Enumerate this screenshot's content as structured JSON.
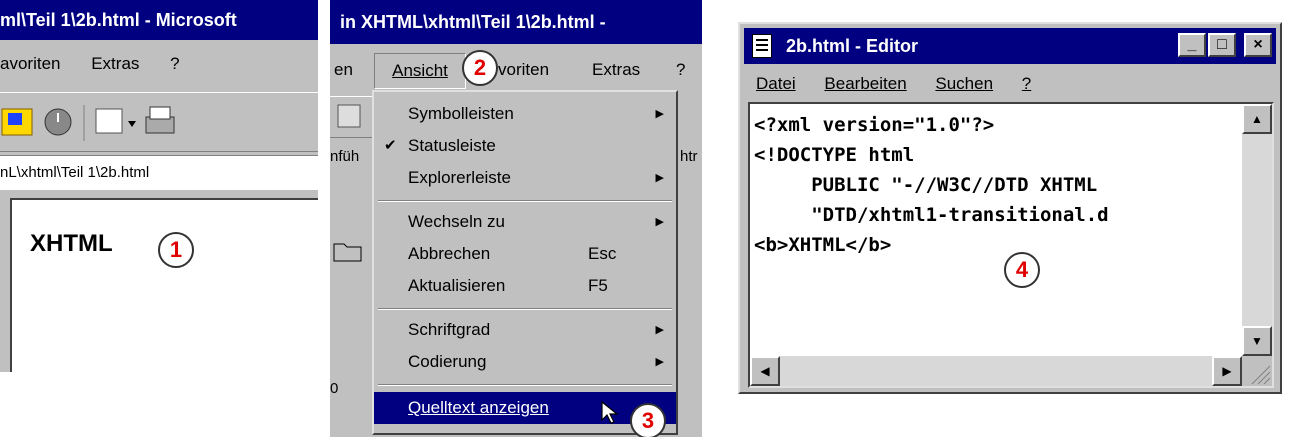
{
  "panel1": {
    "title": "ml\\Teil 1\\2b.html - Microsoft",
    "menu": [
      "avoriten",
      "Extras",
      "?"
    ],
    "address": "nL\\xhtml\\Teil 1\\2b.html",
    "content_text": "XHTML",
    "callout": "1"
  },
  "panel2": {
    "title": "in XHTML\\xhtml\\Teil 1\\2b.html -",
    "menu": {
      "partial": "en",
      "ansicht": "Ansicht",
      "favoriten": "voriten",
      "extras": "Extras",
      "help": "?"
    },
    "callout_menu": "2",
    "callout_source": "3",
    "bg_fragments": [
      "nfüh",
      "htr",
      "0"
    ],
    "dropdown": [
      {
        "label": "Symbolleisten",
        "shortcut": "",
        "submenu": true,
        "checked": false
      },
      {
        "label": "Statusleiste",
        "shortcut": "",
        "submenu": false,
        "checked": true
      },
      {
        "label": "Explorerleiste",
        "shortcut": "",
        "submenu": true,
        "checked": false
      },
      {
        "label": "Wechseln zu",
        "shortcut": "",
        "submenu": true,
        "checked": false
      },
      {
        "label": "Abbrechen",
        "shortcut": "Esc",
        "submenu": false,
        "checked": false
      },
      {
        "label": "Aktualisieren",
        "shortcut": "F5",
        "submenu": false,
        "checked": false
      },
      {
        "label": "Schriftgrad",
        "shortcut": "",
        "submenu": true,
        "checked": false
      },
      {
        "label": "Codierung",
        "shortcut": "",
        "submenu": true,
        "checked": false
      },
      {
        "label": "Quelltext anzeigen",
        "shortcut": "",
        "submenu": false,
        "checked": false,
        "highlighted": true
      }
    ]
  },
  "panel3": {
    "title": "2b.html - Editor",
    "buttons": {
      "minimize": "_",
      "maximize": "□",
      "close": "×"
    },
    "menu": [
      "Datei",
      "Bearbeiten",
      "Suchen",
      "?"
    ],
    "code_lines": [
      "<?xml version=\"1.0\"?>",
      "<!DOCTYPE html",
      "     PUBLIC \"-//W3C//DTD XHTML",
      "     \"DTD/xhtml1-transitional.d",
      "<b>XHTML</b>"
    ],
    "callout": "4"
  },
  "colors": {
    "titlebar": "#000080",
    "face": "#c0c0c0",
    "callout_text": "#e00000"
  }
}
